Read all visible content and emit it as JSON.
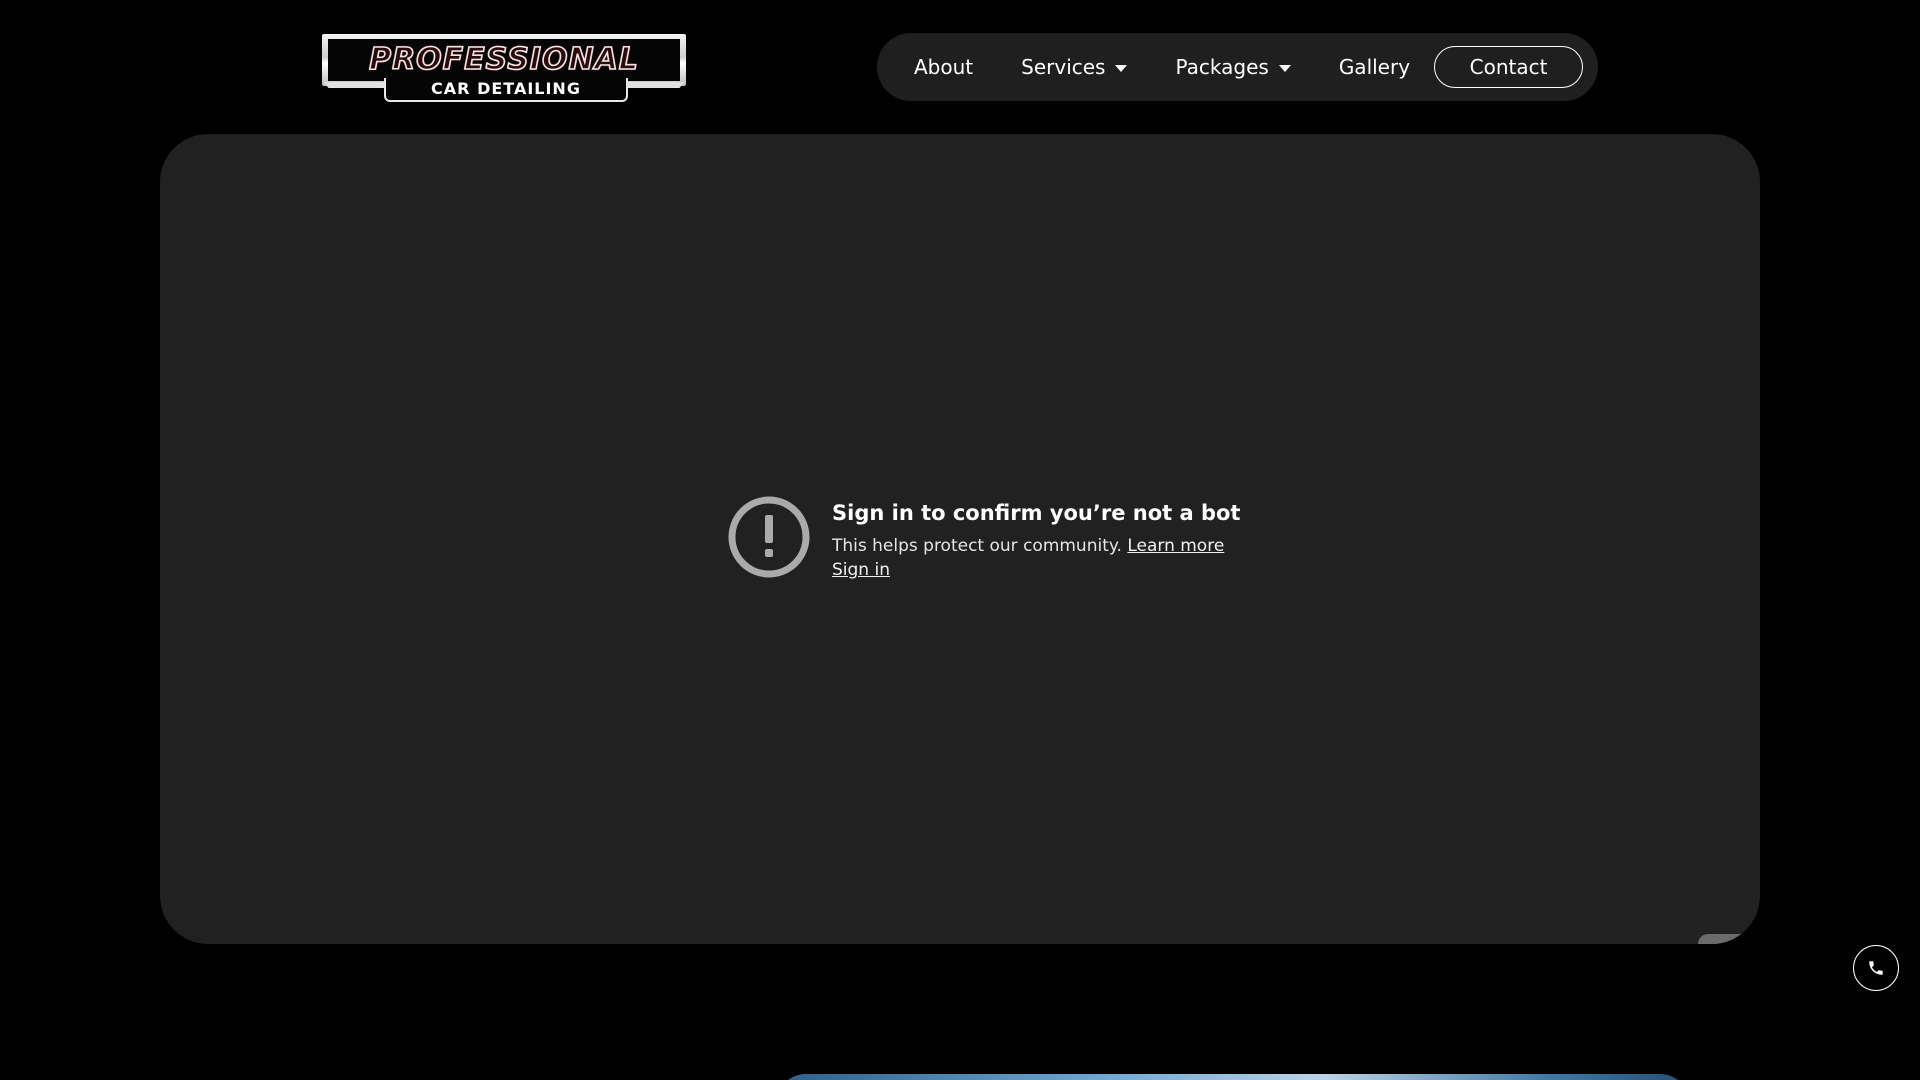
{
  "logo": {
    "main_text": "PROFESSIONAL",
    "sub_text": "CAR DETAILING"
  },
  "nav": {
    "items": [
      {
        "label": "About"
      },
      {
        "label": "Services"
      },
      {
        "label": "Packages"
      },
      {
        "label": "Gallery"
      }
    ],
    "contact_label": "Contact"
  },
  "embed": {
    "title": "Sign in to confirm you’re not a bot",
    "body": "This helps protect our community.",
    "learn_more": "Learn more",
    "sign_in": "Sign in",
    "icon": "alert-circle-icon"
  },
  "floating": {
    "icon": "phone-icon"
  },
  "colors": {
    "background": "#000000",
    "nav_bg": "#1f1f1f",
    "embed_bg": "#212121",
    "text": "#ffffff",
    "icon_gray": "#aaaaaa"
  }
}
